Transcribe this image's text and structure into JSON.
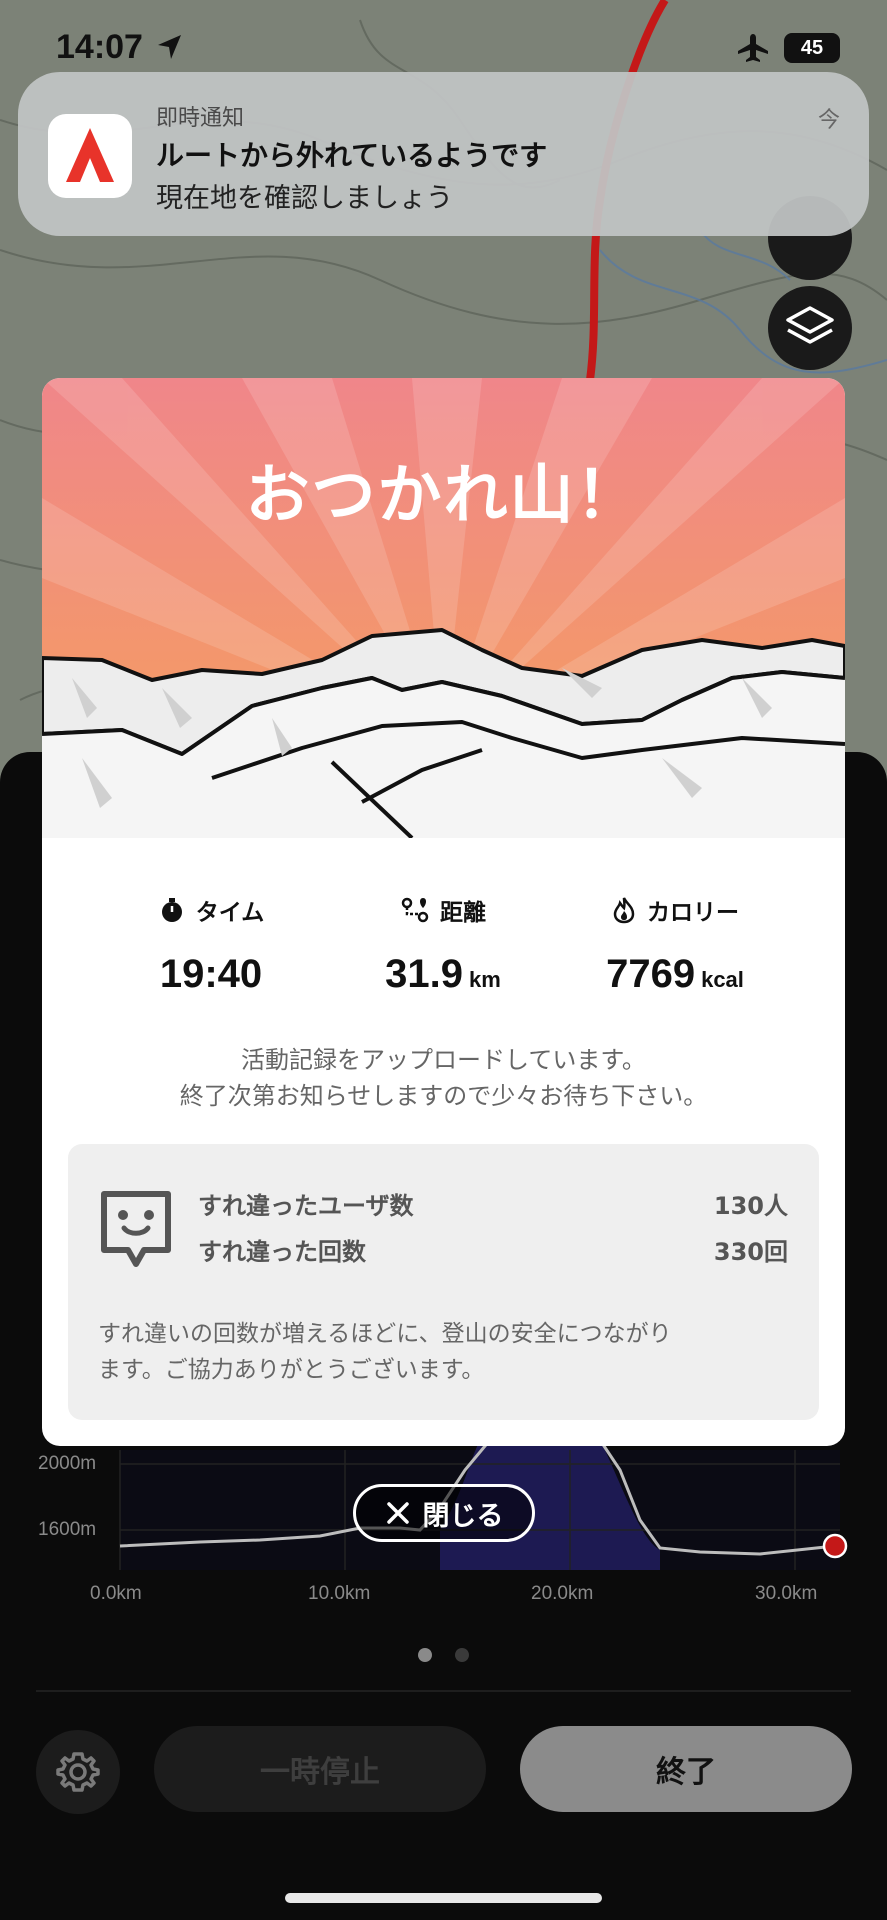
{
  "status_bar": {
    "time": "14:07",
    "battery": "45",
    "location_icon": "location-arrow-icon",
    "airplane_icon": "airplane-icon"
  },
  "notification": {
    "app_name": "即時通知",
    "title": "ルートから外れているようです",
    "body": "現在地を確認しましょう",
    "time": "今",
    "icon": "app-logo-icon",
    "brand_color": "#e8332a"
  },
  "modal": {
    "title": "おつかれ山！",
    "stats": [
      {
        "label": "タイム",
        "value": "19:40",
        "unit": "",
        "icon": "stopwatch-icon"
      },
      {
        "label": "距離",
        "value": "31.9",
        "unit": "km",
        "icon": "route-icon"
      },
      {
        "label": "カロリー",
        "value": "7769",
        "unit": "kcal",
        "icon": "flame-icon"
      }
    ],
    "upload_message_line1": "活動記録をアップロードしています。",
    "upload_message_line2": "終了次第お知らせしますので少々お待ち下さい。",
    "encounter": {
      "icon": "encounter-face-icon",
      "users_label": "すれ違ったユーザ数",
      "users_value": "130人",
      "count_label": "すれ違った回数",
      "count_value": "330回",
      "note_line1": "すれ違いの回数が増えるほどに、登山の安全につながり",
      "note_line2": "ます。ご協力ありがとうございます。"
    },
    "hero_colors": {
      "top": "#f0868a",
      "bottom": "#f5a15a"
    }
  },
  "close_button": {
    "label": "閉じる"
  },
  "elevation": {
    "y_labels": [
      "2000m",
      "1600m"
    ],
    "x_labels": [
      "0.0km",
      "10.0km",
      "20.0km",
      "30.0km"
    ]
  },
  "pager": {
    "pages": 2,
    "active": 0
  },
  "controls": {
    "settings_icon": "gear-icon",
    "pause_label": "一時停止",
    "end_label": "終了"
  }
}
